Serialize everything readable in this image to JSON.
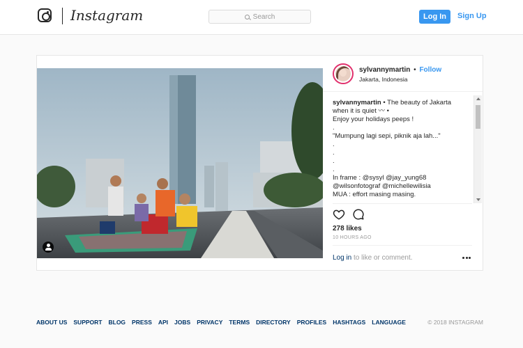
{
  "header": {
    "brand": "Instagram",
    "search_placeholder": "Search",
    "login_label": "Log In",
    "signup_label": "Sign Up"
  },
  "post": {
    "username": "sylvannymartin",
    "separator": "•",
    "follow_label": "Follow",
    "location": "Jakarta, Indonesia",
    "caption_lines": [
      "• The beauty of Jakarta",
      "when it is quiet 〰 •",
      "Enjoy your holidays peeps !",
      ".",
      "\"Mumpung lagi sepi, piknik aja lah...\"",
      ".",
      ".",
      ".",
      ".",
      "In frame : @sysyl @jay_yung68",
      "@wilsonfotograf @michellewilisia",
      "MUA : effort masing masing."
    ],
    "likes": "278 likes",
    "time_ago": "10 HOURS AGO",
    "comment_login": "Log in",
    "comment_prompt": " to like or comment."
  },
  "footer": {
    "links": [
      "ABOUT US",
      "SUPPORT",
      "BLOG",
      "PRESS",
      "API",
      "JOBS",
      "PRIVACY",
      "TERMS",
      "DIRECTORY",
      "PROFILES",
      "HASHTAGS",
      "LANGUAGE"
    ],
    "copyright": "© 2018 INSTAGRAM"
  },
  "colors": {
    "accent": "#3897f0",
    "link_dark": "#003569",
    "muted": "#999999"
  }
}
